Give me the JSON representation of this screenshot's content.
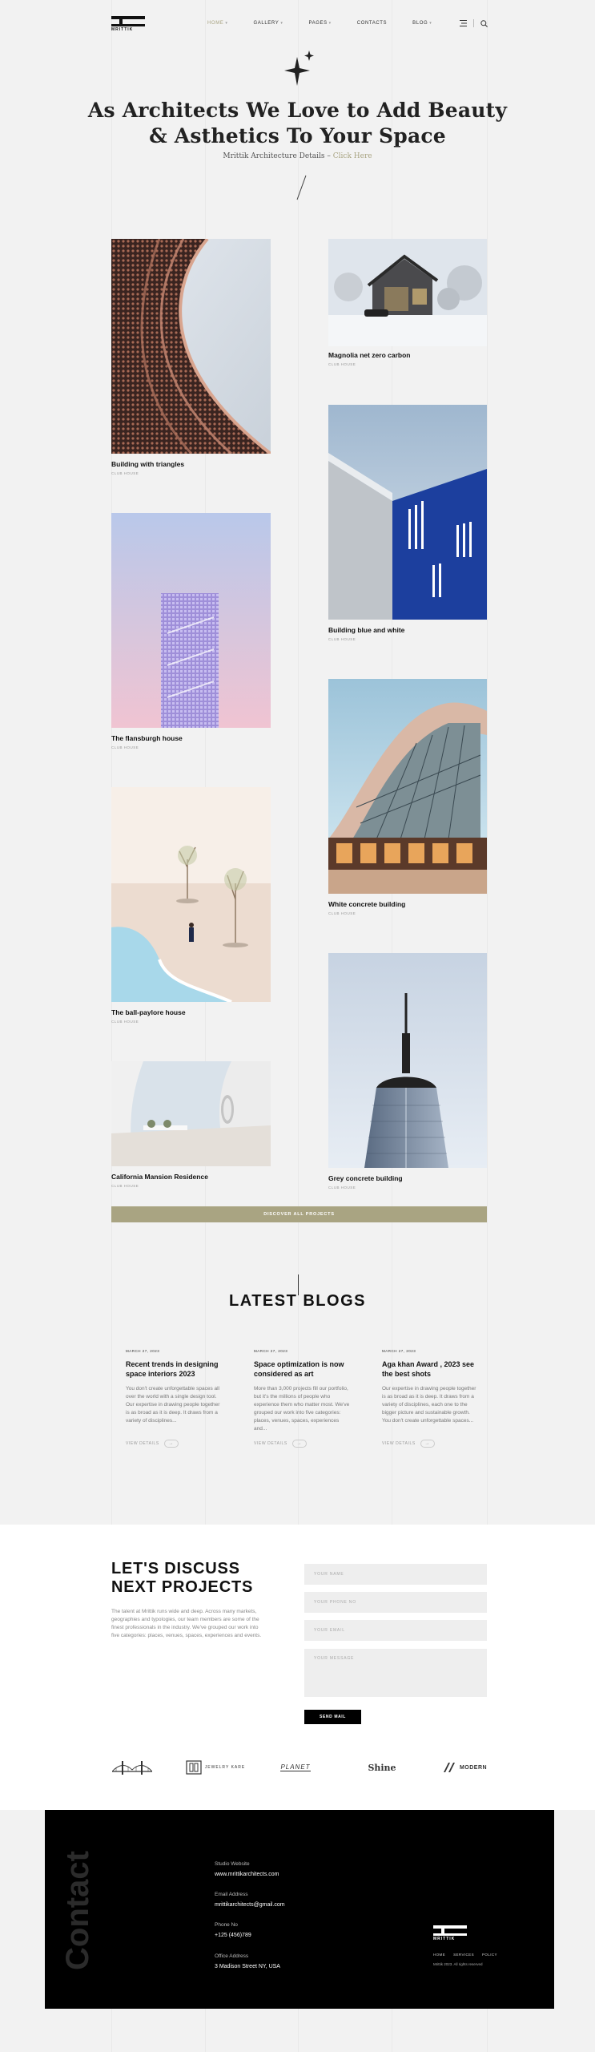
{
  "header": {
    "logo_text": "MRITTIK",
    "nav": [
      {
        "label": "Home",
        "active": true,
        "dropdown": true
      },
      {
        "label": "Gallery",
        "active": false,
        "dropdown": true
      },
      {
        "label": "Pages",
        "active": false,
        "dropdown": true
      },
      {
        "label": "Contacts",
        "active": false,
        "dropdown": false
      },
      {
        "label": "Blog",
        "active": false,
        "dropdown": true
      }
    ],
    "icons": [
      "menu-icon",
      "search-icon"
    ]
  },
  "hero": {
    "title_line1": "As Architects We Love to Add Beauty",
    "title_line2": "& Asthetics To Your Space",
    "sub_text": "Mrittik Architecture Details",
    "sub_sep": "–",
    "sub_link": "Click Here"
  },
  "projects": [
    {
      "name": "Building with triangles",
      "category": "Club House"
    },
    {
      "name": "Magnolia net zero carbon",
      "category": "Club House"
    },
    {
      "name": "The flansburgh house",
      "category": "Club House"
    },
    {
      "name": "Building blue and white",
      "category": "Club House"
    },
    {
      "name": "The ball-paylore house",
      "category": "Club House"
    },
    {
      "name": "White concrete building",
      "category": "Club House"
    },
    {
      "name": "California Mansion Residence",
      "category": "Club House"
    },
    {
      "name": "Grey concrete building",
      "category": "Club House"
    }
  ],
  "discover_label": "Discover All Projects",
  "blogs": {
    "title": "LATEST BLOGS",
    "more_label": "View Details",
    "arrow": "→",
    "items": [
      {
        "date": "March 27, 2023",
        "title": "Recent trends in designing space interiors 2023",
        "excerpt": "You don't create unforgettable spaces all over the world with a single design tool. Our expertise in drawing people together is as broad as it is deep. It draws from a variety of disciplines..."
      },
      {
        "date": "March 27, 2023",
        "title": "Space optimization is now considered as art",
        "excerpt": "More than 3,000 projects fill our portfolio, but it's the millions of people who experience them who matter most. We've grouped our work into five categories: places, venues, spaces, experiences and..."
      },
      {
        "date": "March 27, 2023",
        "title": "Aga khan Award , 2023 see the best shots",
        "excerpt": "Our expertise in drawing people together is as broad as it is deep. It draws from a variety of disciplines, each one to the bigger picture and sustainable growth. You don't create unforgettable spaces..."
      }
    ]
  },
  "discuss": {
    "title_line1": "LET'S DISCUSS",
    "title_line2": "NEXT PROJECTS",
    "text": "The talent at Mrittik runs wide and deep. Across many markets, geographies and typologies, our team members are some of the finest professionals in the industry. We've grouped our work into five categories: places, venues, spaces, experiences and events.",
    "fields": {
      "name": "Your Name",
      "phone": "Your Phone No",
      "email": "Your Email",
      "message": "Your Message"
    },
    "send_label": "Send Mail"
  },
  "brands": [
    {
      "name": "bridge-logo",
      "text": ""
    },
    {
      "name": "jewelry-logo",
      "text": "JEWELRY KARE"
    },
    {
      "name": "planet-logo",
      "text": "PLANET"
    },
    {
      "name": "shine-logo",
      "text": "Shine"
    },
    {
      "name": "modern-logo",
      "text": "MODERN"
    }
  ],
  "contact": {
    "vertical_title": "Contact",
    "items": [
      {
        "label": "Studio Website",
        "value": "www.mrittikarchitects.com"
      },
      {
        "label": "Email Address",
        "value": "mrittikarchitects@gmail.com"
      },
      {
        "label": "Phone No",
        "value": "+125 (456)789"
      },
      {
        "label": "Office Address",
        "value": "3 Madison Street NY, USA"
      }
    ],
    "footer_logo_text": "MRITTIK",
    "footer_nav": [
      "Home",
      "Services",
      "Policy"
    ],
    "copyright": "Mrittik 2023. All rights reserved"
  },
  "colors": {
    "accent": "#a9a482",
    "background": "#f2f2f2",
    "dark": "#000000"
  }
}
